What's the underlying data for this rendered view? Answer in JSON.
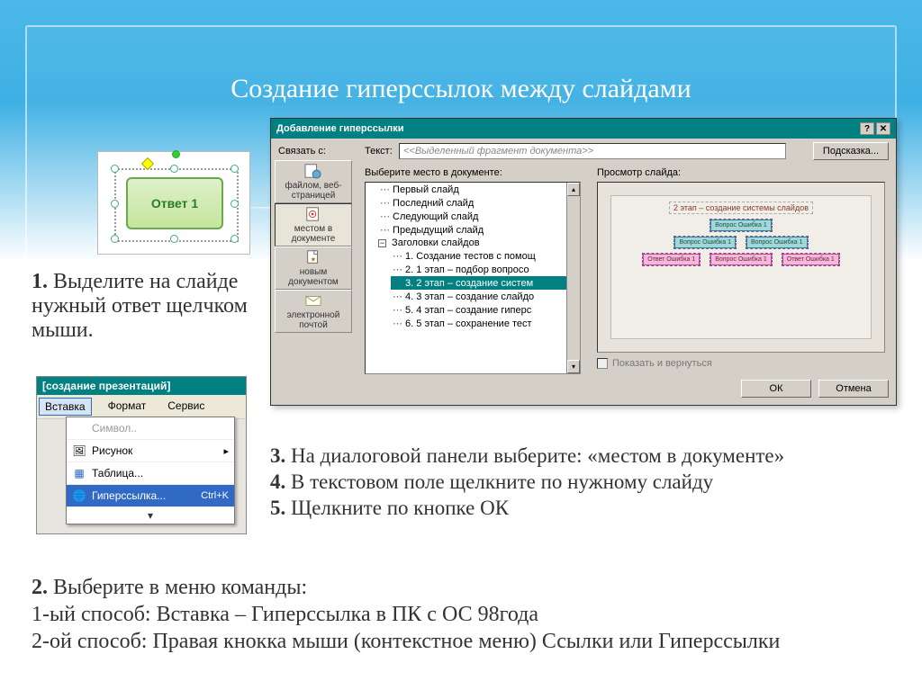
{
  "title": "Создание гиперссылок между слайдами",
  "answer_label": "Ответ 1",
  "step1": {
    "num": "1.",
    "text": " Выделите на слайде нужный ответ щелчком мыши."
  },
  "menu": {
    "window_title": "[создание презентаций]",
    "tabs": [
      "Вставка",
      "Формат",
      "Сервис"
    ],
    "items": [
      {
        "label": "Символ..",
        "disabled": true
      },
      {
        "label": "Рисунок",
        "arrow": true
      },
      {
        "label": "Таблица..."
      },
      {
        "label": "Гиперссылка...",
        "shortcut": "Ctrl+K",
        "sel": true
      }
    ]
  },
  "dialog": {
    "title": "Добавление гиперссылки",
    "link_label": "Связать с:",
    "text_label": "Текст:",
    "text_value": "<<Выделенный фрагмент документа>>",
    "tip_btn": "Подсказка...",
    "side": [
      {
        "label": "файлом, веб-страницей"
      },
      {
        "label": "местом в документе",
        "active": true
      },
      {
        "label": "новым документом"
      },
      {
        "label": "электронной почтой"
      }
    ],
    "tree_label": "Выберите место в документе:",
    "tree": {
      "top": [
        "Первый слайд",
        "Последний слайд",
        "Следующий слайд",
        "Предыдущий слайд"
      ],
      "group": "Заголовки слайдов",
      "items": [
        "1. Создание тестов с помощ",
        "2. 1 этап – подбор вопросо",
        "3. 2 этап – создание систем",
        "4. 3 этап – создание слайдо",
        "5. 4 этап – создание гиперс",
        "6. 5 этап – сохранение тест"
      ],
      "selected": 2
    },
    "preview_label": "Просмотр слайда:",
    "preview_title": "2 этап – создание системы слайдов",
    "preview_nodes": {
      "r1": [
        "Вопрос\\nОшибка 1"
      ],
      "r2": [
        "Вопрос\\nОшибка 1",
        "Вопрос\\nОшибка 1"
      ],
      "r3": [
        "Ответ\\nОшибка 1",
        "Вопрос\\nОшибка 1",
        "Ответ\\nОшибка 1"
      ]
    },
    "show_return": "Показать и вернуться",
    "ok": "ОК",
    "cancel": "Отмена"
  },
  "step345": {
    "l3a": "3.",
    "l3b": " На диалоговой панели выберите: «местом в документе»",
    "l4a": "4.",
    "l4b": " В текстовом поле щелкните по нужному слайду",
    "l5a": "5.",
    "l5b": " Щелкните по кнопке ОК"
  },
  "step2": {
    "a": "2.",
    "b": " Выберите в меню команды:",
    "c": "1-ый способ: Вставка – Гиперссылка в ПК с ОС 98года",
    "d": "2-ой способ: Правая кнокка мыши (контекстное меню) Ссылки или Гиперссылки"
  }
}
